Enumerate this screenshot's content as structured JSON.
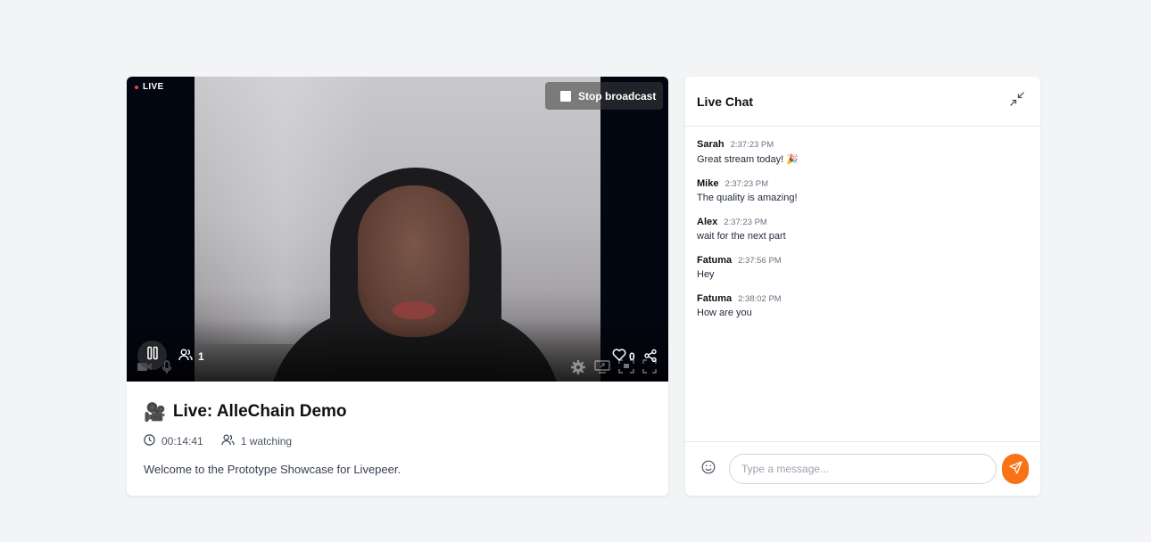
{
  "player": {
    "live_label": "LIVE",
    "stop_broadcast_label": "Stop broadcast",
    "viewer_count": "1",
    "like_count": "0"
  },
  "stream": {
    "title_emoji": "🎥",
    "title": "Live: AlleChain Demo",
    "duration": "00:14:41",
    "watching": "1 watching",
    "description": "Welcome to the Prototype Showcase for Livepeer."
  },
  "chat": {
    "title": "Live Chat",
    "messages": [
      {
        "user": "Sarah",
        "time": "2:37:23 PM",
        "text": "Great stream today! 🎉"
      },
      {
        "user": "Mike",
        "time": "2:37:23 PM",
        "text": "The quality is amazing!"
      },
      {
        "user": "Alex",
        "time": "2:37:23 PM",
        "text": "wait for the next part"
      },
      {
        "user": "Fatuma",
        "time": "2:37:56 PM",
        "text": "Hey"
      },
      {
        "user": "Fatuma",
        "time": "2:38:02 PM",
        "text": "How are you"
      }
    ],
    "input_placeholder": "Type a message..."
  },
  "colors": {
    "accent": "#f97316",
    "live_dot": "#ef4444",
    "page_bg": "#f3f4f6"
  },
  "icons": [
    "pause-icon",
    "users-icon",
    "heart-icon",
    "share-icon",
    "camera-icon",
    "mic-icon",
    "settings-icon",
    "screen-share-icon",
    "pip-icon",
    "fullscreen-icon",
    "clock-icon",
    "collapse-icon",
    "smile-icon",
    "send-icon"
  ]
}
